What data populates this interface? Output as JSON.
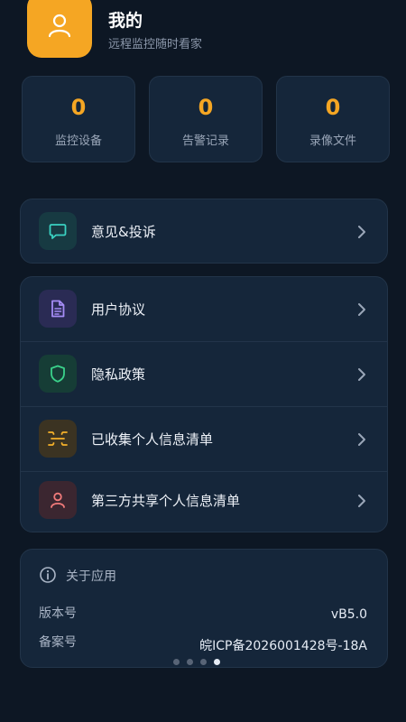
{
  "profile": {
    "title": "我的",
    "subtitle": "远程监控随时看家",
    "avatar_icon": "user-icon",
    "avatar_color": "#f5a623"
  },
  "stats": [
    {
      "value": "0",
      "label": "监控设备"
    },
    {
      "value": "0",
      "label": "告警记录"
    },
    {
      "value": "0",
      "label": "录像文件"
    }
  ],
  "menu_feedback": {
    "label": "意见&投诉",
    "icon": "chat-bubble-icon",
    "color": "#3ad1c1"
  },
  "menu_legal": [
    {
      "label": "用户协议",
      "icon": "document-icon",
      "color": "#a58cf5"
    },
    {
      "label": "隐私政策",
      "icon": "shield-icon",
      "color": "#3ad18a"
    },
    {
      "label": "已收集个人信息清单",
      "icon": "collection-icon",
      "color": "#f5b12a"
    },
    {
      "label": "第三方共享个人信息清单",
      "icon": "person-icon",
      "color": "#f07a7a"
    }
  ],
  "about": {
    "title": "关于应用",
    "icon": "info-icon",
    "version_label": "版本号",
    "version_value": "vB5.0",
    "icp_label": "备案号",
    "icp_value": "皖ICP备2026001428号-18A"
  },
  "pager": {
    "count": 4,
    "active": 4
  }
}
